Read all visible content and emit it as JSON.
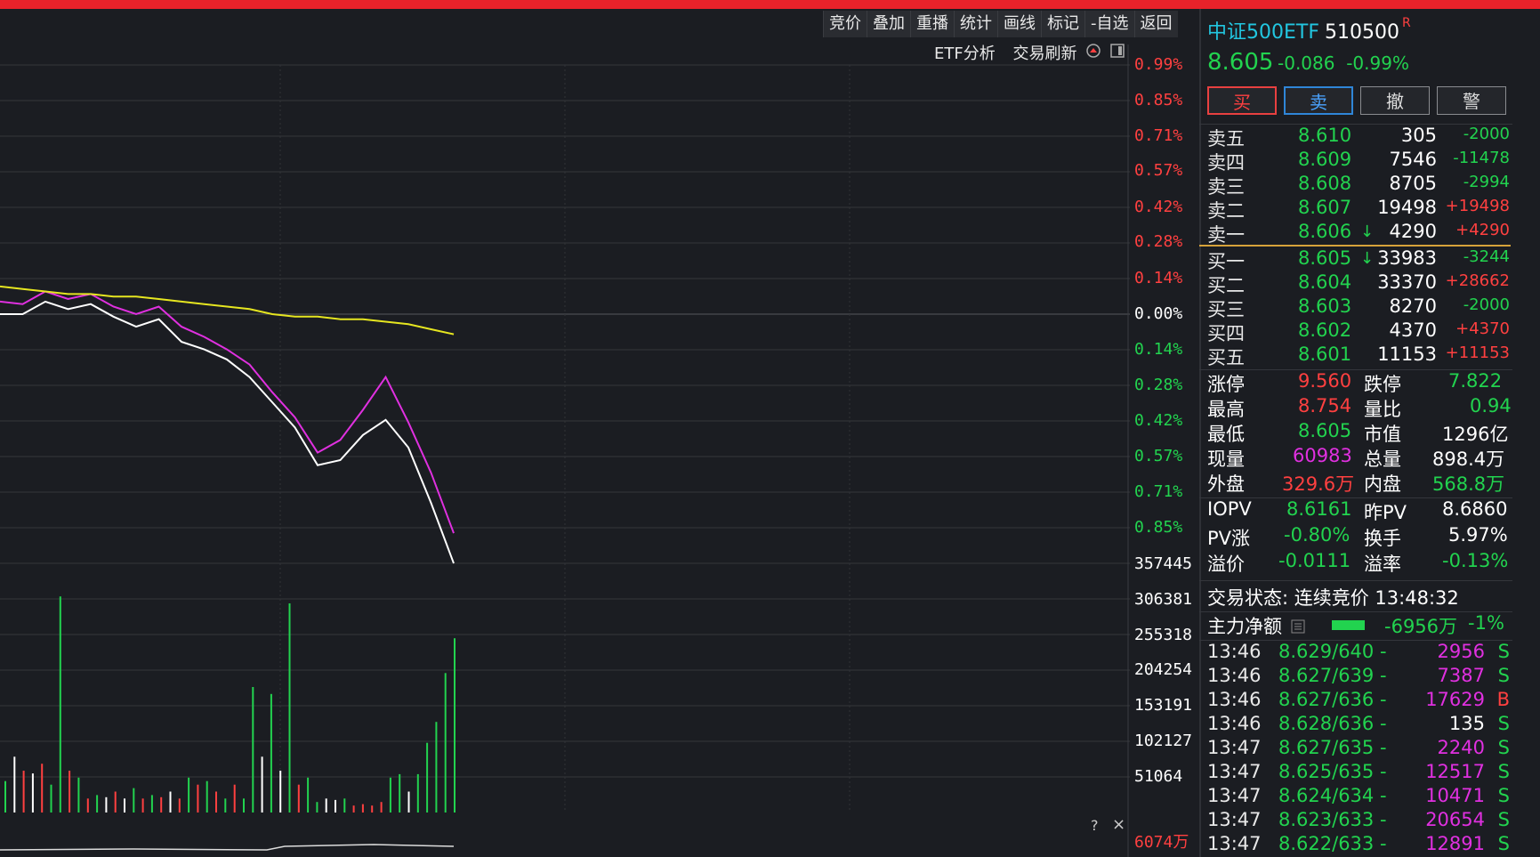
{
  "toolbar": {
    "items": [
      "竞价",
      "叠加",
      "重播",
      "统计",
      "画线",
      "标记",
      "-自选",
      "返回"
    ]
  },
  "subtoolbar": {
    "etf_analysis": "ETF分析",
    "trade_refresh": "交易刷新"
  },
  "price_axis": [
    "0.99%",
    "0.85%",
    "0.71%",
    "0.57%",
    "0.42%",
    "0.28%",
    "0.14%",
    "0.00%",
    "0.14%",
    "0.28%",
    "0.42%",
    "0.57%",
    "0.71%",
    "0.85%"
  ],
  "volume_axis": [
    "357445",
    "306381",
    "255318",
    "204254",
    "153191",
    "102127",
    "51064"
  ],
  "bottom_indicator": "6074万",
  "help_glyph": "?",
  "close_glyph": "×",
  "header": {
    "name": "中证500ETF",
    "code": "510500",
    "badge": "R",
    "price": "8.605",
    "change": "-0.086",
    "change_pct": "-0.99%"
  },
  "buttons": {
    "buy": "买",
    "sell": "卖",
    "cancel": "撤",
    "alert": "警"
  },
  "asks": [
    {
      "label": "卖五",
      "price": "8.610",
      "arrow": "",
      "vol": "305",
      "diff": "-2000"
    },
    {
      "label": "卖四",
      "price": "8.609",
      "arrow": "",
      "vol": "7546",
      "diff": "-11478"
    },
    {
      "label": "卖三",
      "price": "8.608",
      "arrow": "",
      "vol": "8705",
      "diff": "-2994"
    },
    {
      "label": "卖二",
      "price": "8.607",
      "arrow": "",
      "vol": "19498",
      "diff": "+19498"
    },
    {
      "label": "卖一",
      "price": "8.606",
      "arrow": "↓",
      "vol": "4290",
      "diff": "+4290"
    }
  ],
  "bids": [
    {
      "label": "买一",
      "price": "8.605",
      "arrow": "↓",
      "vol": "33983",
      "diff": "-3244"
    },
    {
      "label": "买二",
      "price": "8.604",
      "arrow": "",
      "vol": "33370",
      "diff": "+28662"
    },
    {
      "label": "买三",
      "price": "8.603",
      "arrow": "",
      "vol": "8270",
      "diff": "-2000"
    },
    {
      "label": "买四",
      "price": "8.602",
      "arrow": "",
      "vol": "4370",
      "diff": "+4370"
    },
    {
      "label": "买五",
      "price": "8.601",
      "arrow": "",
      "vol": "11153",
      "diff": "+11153"
    }
  ],
  "stats": {
    "limit_up_label": "涨停",
    "limit_up": "9.560",
    "limit_down_label": "跌停",
    "limit_down": "7.822",
    "high_label": "最高",
    "high": "8.754",
    "vol_ratio_label": "量比",
    "vol_ratio": "0.94",
    "low_label": "最低",
    "low": "8.605",
    "mktcap_label": "市值",
    "mktcap": "1296亿",
    "cur_vol_label": "现量",
    "cur_vol": "60983",
    "total_vol_label": "总量",
    "total_vol": "898.4万",
    "outer_label": "外盘",
    "outer": "329.6万",
    "inner_label": "内盘",
    "inner": "568.8万",
    "iopv_label": "IOPV",
    "iopv": "8.6161",
    "prev_pv_label": "昨PV",
    "prev_pv": "8.6860",
    "pv_chg_label": "PV涨",
    "pv_chg": "-0.80%",
    "turnover_label": "换手",
    "turnover": "5.97%",
    "premium_label": "溢价",
    "premium": "-0.0111",
    "premium_rate_label": "溢率",
    "premium_rate": "-0.13%"
  },
  "trade_status": "交易状态: 连续竞价 13:48:32",
  "main_flow": {
    "label": "主力净额",
    "value": "-6956万",
    "pct": "-1%"
  },
  "ticks": [
    {
      "time": "13:46",
      "price": "8.629/640 -",
      "vol": "2956",
      "side": "S"
    },
    {
      "time": "13:46",
      "price": "8.627/639 -",
      "vol": "7387",
      "side": "S"
    },
    {
      "time": "13:46",
      "price": "8.627/636 -",
      "vol": "17629",
      "side": "B"
    },
    {
      "time": "13:46",
      "price": "8.628/636 -",
      "vol": "135",
      "side": "S"
    },
    {
      "time": "13:47",
      "price": "8.627/635 -",
      "vol": "2240",
      "side": "S"
    },
    {
      "time": "13:47",
      "price": "8.625/635 -",
      "vol": "12517",
      "side": "S"
    },
    {
      "time": "13:47",
      "price": "8.624/634 -",
      "vol": "10471",
      "side": "S"
    },
    {
      "time": "13:47",
      "price": "8.623/633 -",
      "vol": "20654",
      "side": "S"
    },
    {
      "time": "13:47",
      "price": "8.622/633 -",
      "vol": "12891",
      "side": "S"
    }
  ],
  "colors": {
    "up": "#ff4040",
    "down": "#22d34f",
    "magenta": "#e030e0",
    "avg_line": "#e6e620"
  },
  "chart_data": {
    "type": "line",
    "series": [
      {
        "values": [
          0.0,
          0.0,
          0.05,
          0.02,
          0.04,
          -0.01,
          -0.05,
          -0.02,
          -0.11,
          -0.14,
          -0.18,
          -0.25,
          -0.35,
          -0.45,
          -0.6,
          -0.58,
          -0.48,
          -0.42,
          -0.53,
          -0.75,
          -0.99
        ]
      },
      {
        "values": [
          0.05,
          0.04,
          0.09,
          0.06,
          0.08,
          0.03,
          0.0,
          0.03,
          -0.05,
          -0.09,
          -0.14,
          -0.2,
          -0.31,
          -0.41,
          -0.55,
          -0.5,
          -0.38,
          -0.25,
          -0.43,
          -0.63,
          -0.87
        ]
      },
      {
        "values": [
          0.11,
          0.1,
          0.09,
          0.08,
          0.08,
          0.07,
          0.07,
          0.06,
          0.05,
          0.04,
          0.03,
          0.02,
          0.0,
          -0.01,
          -0.01,
          -0.02,
          -0.02,
          -0.03,
          -0.04,
          -0.06,
          -0.08
        ]
      }
    ],
    "volume": [
      {
        "v": 45000,
        "c": "g"
      },
      {
        "v": 80000,
        "c": "w"
      },
      {
        "v": 60000,
        "c": "r"
      },
      {
        "v": 56000,
        "c": "w"
      },
      {
        "v": 70000,
        "c": "r"
      },
      {
        "v": 40000,
        "c": "g"
      },
      {
        "v": 310000,
        "c": "g"
      },
      {
        "v": 60000,
        "c": "r"
      },
      {
        "v": 50000,
        "c": "g"
      },
      {
        "v": 20000,
        "c": "r"
      },
      {
        "v": 25000,
        "c": "g"
      },
      {
        "v": 22000,
        "c": "w"
      },
      {
        "v": 30000,
        "c": "r"
      },
      {
        "v": 20000,
        "c": "w"
      },
      {
        "v": 35000,
        "c": "g"
      },
      {
        "v": 20000,
        "c": "r"
      },
      {
        "v": 25000,
        "c": "g"
      },
      {
        "v": 22000,
        "c": "r"
      },
      {
        "v": 30000,
        "c": "w"
      },
      {
        "v": 20000,
        "c": "r"
      },
      {
        "v": 50000,
        "c": "g"
      },
      {
        "v": 40000,
        "c": "r"
      },
      {
        "v": 45000,
        "c": "g"
      },
      {
        "v": 30000,
        "c": "r"
      },
      {
        "v": 20000,
        "c": "g"
      },
      {
        "v": 40000,
        "c": "r"
      },
      {
        "v": 20000,
        "c": "g"
      },
      {
        "v": 180000,
        "c": "g"
      },
      {
        "v": 80000,
        "c": "w"
      },
      {
        "v": 170000,
        "c": "g"
      },
      {
        "v": 60000,
        "c": "w"
      },
      {
        "v": 300000,
        "c": "g"
      },
      {
        "v": 40000,
        "c": "r"
      },
      {
        "v": 50000,
        "c": "g"
      },
      {
        "v": 15000,
        "c": "g"
      },
      {
        "v": 20000,
        "c": "w"
      },
      {
        "v": 18000,
        "c": "w"
      },
      {
        "v": 20000,
        "c": "g"
      },
      {
        "v": 10000,
        "c": "r"
      },
      {
        "v": 12000,
        "c": "r"
      },
      {
        "v": 10000,
        "c": "r"
      },
      {
        "v": 15000,
        "c": "r"
      },
      {
        "v": 50000,
        "c": "g"
      },
      {
        "v": 55000,
        "c": "g"
      },
      {
        "v": 30000,
        "c": "w"
      },
      {
        "v": 55000,
        "c": "g"
      },
      {
        "v": 100000,
        "c": "g"
      },
      {
        "v": 130000,
        "c": "g"
      },
      {
        "v": 200000,
        "c": "g"
      },
      {
        "v": 250000,
        "c": "g"
      }
    ],
    "ylim": [
      -0.99,
      0.99
    ]
  }
}
